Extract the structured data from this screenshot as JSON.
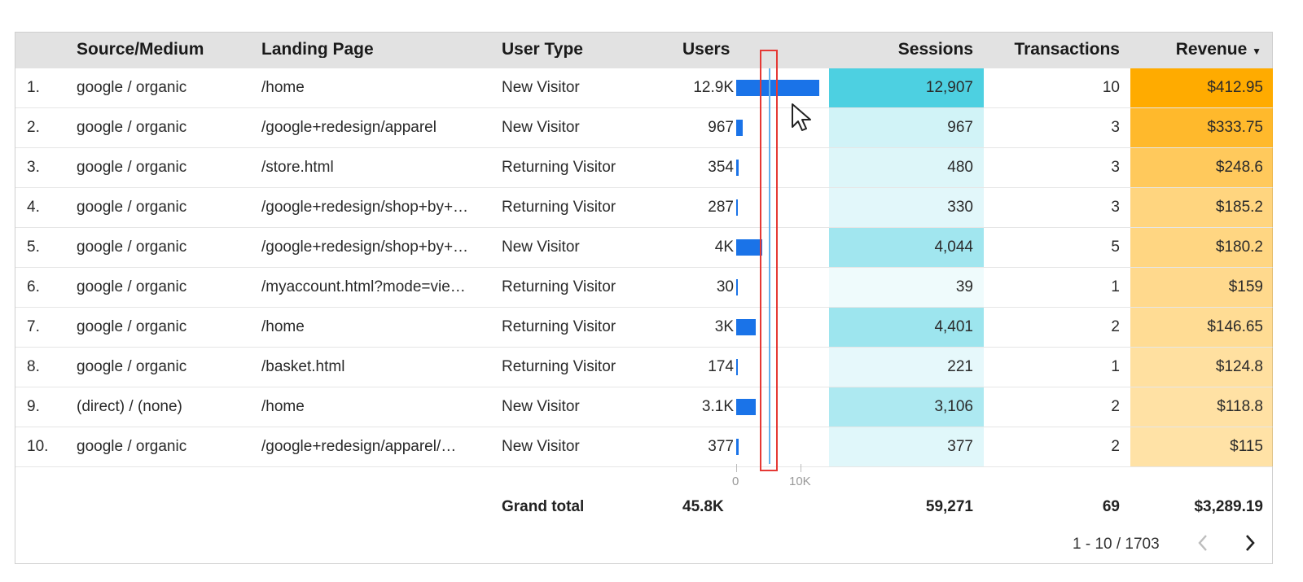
{
  "header": {
    "source_medium": "Source/Medium",
    "landing_page": "Landing Page",
    "user_type": "User Type",
    "users": "Users",
    "sessions": "Sessions",
    "transactions": "Transactions",
    "revenue": "Revenue",
    "revenue_sort_icon": "▼"
  },
  "rows": [
    {
      "idx": "1.",
      "src": "google / organic",
      "page": "/home",
      "type": "New Visitor",
      "users": "12.9K",
      "users_value": 12907,
      "sessions": "12,907",
      "sessions_value": 12907,
      "tx": "10",
      "rev": "$412.95",
      "rev_value": 412.95
    },
    {
      "idx": "2.",
      "src": "google / organic",
      "page": "/google+redesign/apparel",
      "type": "New Visitor",
      "users": "967",
      "users_value": 967,
      "sessions": "967",
      "sessions_value": 967,
      "tx": "3",
      "rev": "$333.75",
      "rev_value": 333.75
    },
    {
      "idx": "3.",
      "src": "google / organic",
      "page": "/store.html",
      "type": "Returning Visitor",
      "users": "354",
      "users_value": 354,
      "sessions": "480",
      "sessions_value": 480,
      "tx": "3",
      "rev": "$248.6",
      "rev_value": 248.6
    },
    {
      "idx": "4.",
      "src": "google / organic",
      "page": "/google+redesign/shop+by+…",
      "type": "Returning Visitor",
      "users": "287",
      "users_value": 287,
      "sessions": "330",
      "sessions_value": 330,
      "tx": "3",
      "rev": "$185.2",
      "rev_value": 185.2
    },
    {
      "idx": "5.",
      "src": "google / organic",
      "page": "/google+redesign/shop+by+…",
      "type": "New Visitor",
      "users": "4K",
      "users_value": 4000,
      "sessions": "4,044",
      "sessions_value": 4044,
      "tx": "5",
      "rev": "$180.2",
      "rev_value": 180.2
    },
    {
      "idx": "6.",
      "src": "google / organic",
      "page": "/myaccount.html?mode=vie…",
      "type": "Returning Visitor",
      "users": "30",
      "users_value": 30,
      "sessions": "39",
      "sessions_value": 39,
      "tx": "1",
      "rev": "$159",
      "rev_value": 159
    },
    {
      "idx": "7.",
      "src": "google / organic",
      "page": "/home",
      "type": "Returning Visitor",
      "users": "3K",
      "users_value": 3000,
      "sessions": "4,401",
      "sessions_value": 4401,
      "tx": "2",
      "rev": "$146.65",
      "rev_value": 146.65
    },
    {
      "idx": "8.",
      "src": "google / organic",
      "page": "/basket.html",
      "type": "Returning Visitor",
      "users": "174",
      "users_value": 174,
      "sessions": "221",
      "sessions_value": 221,
      "tx": "1",
      "rev": "$124.8",
      "rev_value": 124.8
    },
    {
      "idx": "9.",
      "src": "(direct) / (none)",
      "page": "/home",
      "type": "New Visitor",
      "users": "3.1K",
      "users_value": 3100,
      "sessions": "3,106",
      "sessions_value": 3106,
      "tx": "2",
      "rev": "$118.8",
      "rev_value": 118.8
    },
    {
      "idx": "10.",
      "src": "google / organic",
      "page": "/google+redesign/apparel/…",
      "type": "New Visitor",
      "users": "377",
      "users_value": 377,
      "sessions": "377",
      "sessions_value": 377,
      "tx": "2",
      "rev": "$115",
      "rev_value": 115
    }
  ],
  "bar_axis": {
    "min": 0,
    "max": 10000,
    "min_label": "0",
    "max_label": "10K"
  },
  "totals": {
    "label": "Grand total",
    "users": "45.8K",
    "sessions": "59,271",
    "transactions": "69",
    "revenue": "$3,289.19"
  },
  "pagination": {
    "range": "1 - 10 / 1703",
    "prev_icon": "chevron-left-icon",
    "next_icon": "chevron-right-icon"
  },
  "colors": {
    "bar": "#1a73e8",
    "sessions_heat": "#4dd0e1",
    "revenue_heat": "#ffab00",
    "highlight_box": "#e53935",
    "reference_line": "#63b3ed"
  }
}
